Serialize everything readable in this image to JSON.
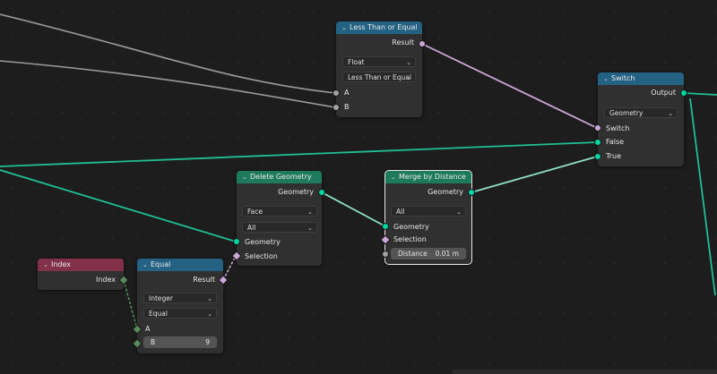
{
  "nodes": {
    "less_than_or_equal": {
      "title": "Less Than or Equal",
      "output": "Result",
      "type_value": "Float",
      "op_value": "Less Than or Equal",
      "input_a": "A",
      "input_b": "B"
    },
    "switch": {
      "title": "Switch",
      "output": "Output",
      "type_value": "Geometry",
      "input_switch": "Switch",
      "input_false": "False",
      "input_true": "True"
    },
    "delete_geometry": {
      "title": "Delete Geometry",
      "output": "Geometry",
      "domain_value": "Face",
      "mode_value": "All",
      "input_geometry": "Geometry",
      "input_selection": "Selection"
    },
    "merge_by_distance": {
      "title": "Merge by Distance",
      "output": "Geometry",
      "mode_value": "All",
      "input_geometry": "Geometry",
      "input_selection": "Selection",
      "distance_label": "Distance",
      "distance_value": "0.01 m"
    },
    "index": {
      "title": "Index",
      "output": "Index"
    },
    "equal": {
      "title": "Equal",
      "output": "Result",
      "type_value": "Integer",
      "op_value": "Equal",
      "input_a": "A",
      "input_b_label": "B",
      "input_b_value": "9"
    }
  },
  "colors": {
    "background": "#1d1d1d",
    "node_body": "#303030",
    "header_function": "#246283",
    "header_geometry": "#1e7a5c",
    "header_input": "#83314a",
    "socket_geometry": "#00d6a3",
    "socket_boolean": "#cca6d6",
    "socket_float": "#a1a1a1",
    "socket_integer": "#598c5c"
  }
}
